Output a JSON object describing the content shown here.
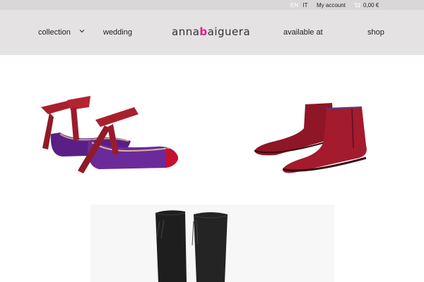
{
  "topbar": {
    "lang_en": "EN",
    "lang_it": "IT",
    "account": "My account",
    "cart_total": "0,00 €",
    "cart_icon": "cart-icon"
  },
  "header": {
    "logo_part1": "anna",
    "logo_part2": "b",
    "logo_part3": "aiguera",
    "nav": {
      "collection": "collection",
      "wedding": "wedding",
      "available": "available at",
      "shop": "shop"
    }
  },
  "colors": {
    "topbar_bg": "#d9d7d7",
    "header_bg": "#e4e2e2",
    "logo_accent": "#e3168c",
    "velvet_red": "#9b1b2c",
    "velvet_purple": "#6b2a9a"
  },
  "products": [
    {
      "name": "purple velvet ballet flats with red ribbon ties"
    },
    {
      "name": "red velvet ankle boots"
    },
    {
      "name": "black suede over-the-knee boots"
    }
  ]
}
